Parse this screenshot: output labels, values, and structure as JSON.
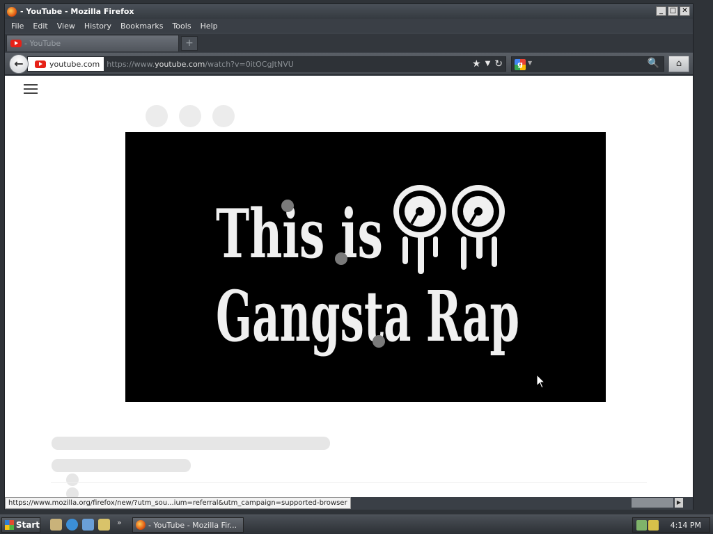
{
  "window": {
    "title": "- YouTube - Mozilla Firefox",
    "controls": {
      "minimize": "_",
      "maximize": "□",
      "close": "✕"
    }
  },
  "menu": [
    "File",
    "Edit",
    "View",
    "History",
    "Bookmarks",
    "Tools",
    "Help"
  ],
  "tabs": [
    {
      "label": "- YouTube",
      "icon": "youtube-icon"
    }
  ],
  "new_tab_label": "+",
  "navbar": {
    "back_label": "←",
    "identity_host": "youtube.com",
    "url_prefix": "https://www.",
    "url_host": "youtube.com",
    "url_path": "/watch?v=0itOCgJtNVU",
    "bookmark_star": "★",
    "dropdown": "▼",
    "reload": "↻",
    "search_glyph": "🔍",
    "home_glyph": "⌂"
  },
  "video": {
    "logo_line1": "This is",
    "logo_line2": "Gangsta Rap",
    "background_color": "#000000",
    "logo_color": "#f0f0f0"
  },
  "status_bar": {
    "link": "https://www.mozilla.org/firefox/new/?utm_sou...ium=referral&utm_campaign=supported-browser"
  },
  "taskbar": {
    "start_label": "Start",
    "task_label": "- YouTube - Mozilla Fir...",
    "more": "»",
    "clock": "4:14 PM"
  },
  "colors": {
    "youtube_red": "#e62117",
    "chrome_dark": "#3d4249"
  }
}
